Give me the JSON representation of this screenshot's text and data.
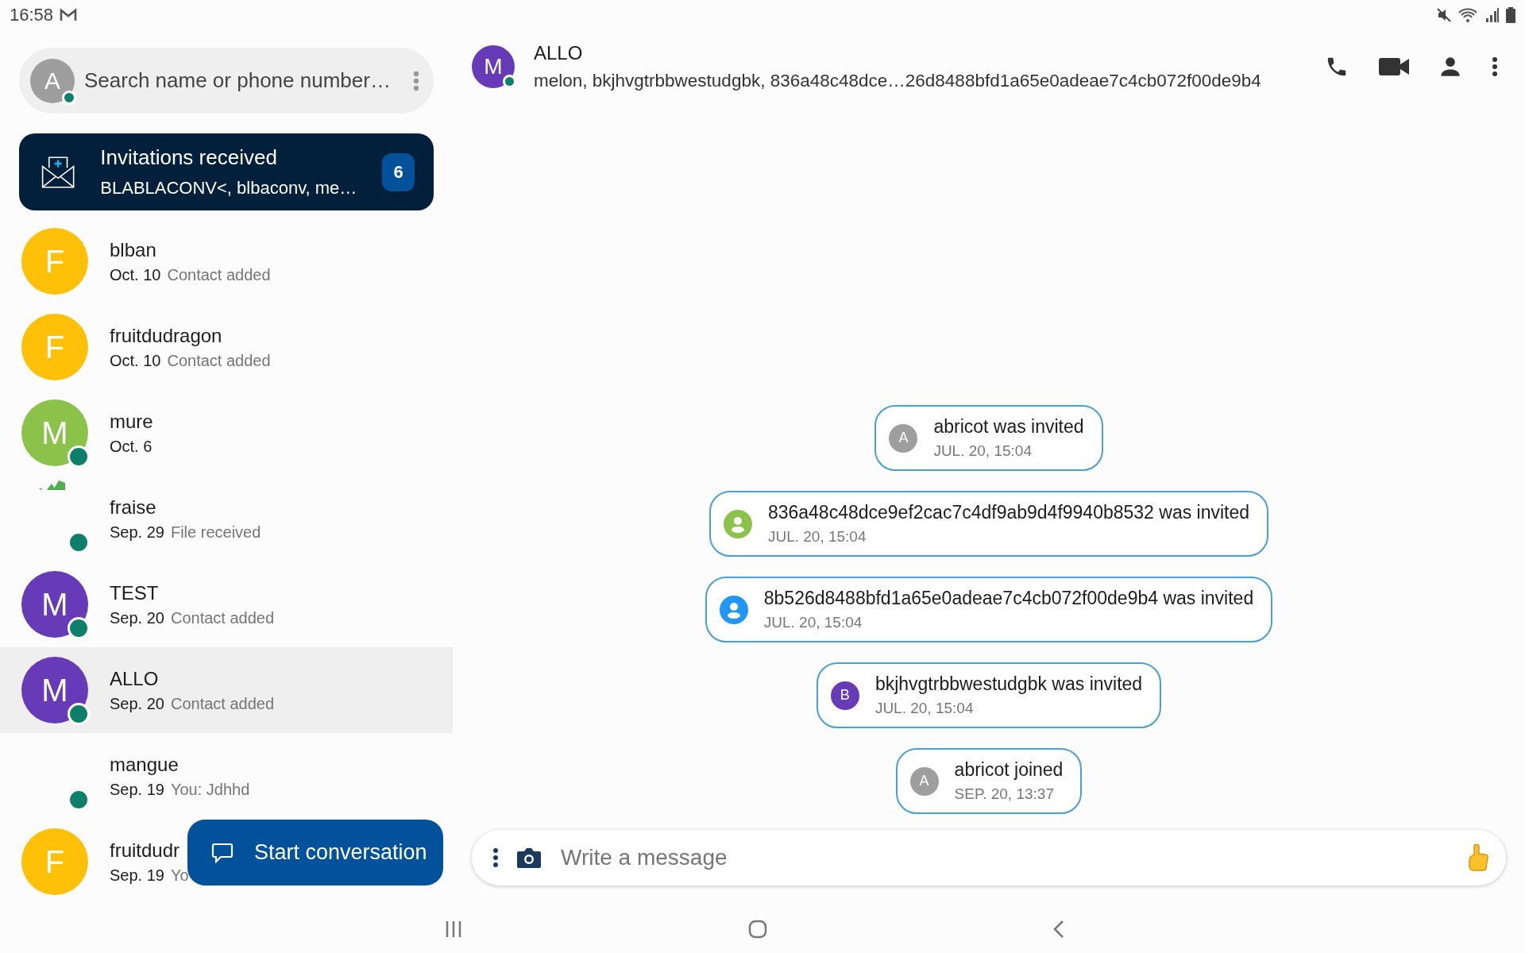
{
  "status_bar": {
    "time": "16:58"
  },
  "search": {
    "avatar_initial": "A",
    "online": true,
    "placeholder": "Search name or phone number…"
  },
  "invitations": {
    "title": "Invitations received",
    "subtitle": "BLABLACONV<, blbaconv, me…",
    "count": "6"
  },
  "contacts": [
    {
      "kind": "letter",
      "initial": "F",
      "color": "#ffc107",
      "name": "blban",
      "date": "Oct. 10",
      "preview": "Contact added",
      "online": false,
      "selected": false
    },
    {
      "kind": "letter",
      "initial": "F",
      "color": "#ffc107",
      "name": "fruitdudragon",
      "date": "Oct. 10",
      "preview": "Contact added",
      "online": false,
      "selected": false
    },
    {
      "kind": "letter",
      "initial": "M",
      "color": "#8bc34a",
      "name": "mure",
      "date": "Oct. 6",
      "online": true,
      "selected": false
    },
    {
      "kind": "broken-image",
      "name": "fraise",
      "date": "Sep. 29",
      "preview": "File received",
      "online": true,
      "selected": false
    },
    {
      "kind": "letter",
      "initial": "M",
      "color": "#673ab7",
      "name": "TEST",
      "date": "Sep. 20",
      "preview": "Contact added",
      "online": true,
      "selected": false
    },
    {
      "kind": "letter",
      "initial": "M",
      "color": "#673ab7",
      "name": "ALLO",
      "date": "Sep. 20",
      "preview": "Contact added",
      "online": true,
      "selected": true
    },
    {
      "kind": "none",
      "name": "mangue",
      "date": "Sep. 19",
      "preview": "You: Jdhhd",
      "online": true,
      "selected": false
    },
    {
      "kind": "letter",
      "initial": "F",
      "color": "#ffc107",
      "name": "fruitdudr",
      "date": "Sep. 19",
      "preview": "Yo",
      "online": false,
      "selected": false
    }
  ],
  "start_button": {
    "label": "Start conversation"
  },
  "header": {
    "avatar_initial": "M",
    "online": true,
    "title": "ALLO",
    "subtitle": "melon, bkjhvgtrbbwestudgbk, 836a48c48dce…26d8488bfd1a65e0adeae7c4cb072f00de9b4"
  },
  "events": [
    {
      "kind": "letter",
      "initial": "A",
      "color": "#9e9e9e",
      "text": "abricot was invited",
      "time": "JUL. 20, 15:04"
    },
    {
      "kind": "person",
      "color": "#8bc34a",
      "text": "836a48c48dce9ef2cac7c4df9ab9d4f9940b8532 was invited",
      "time": "JUL. 20, 15:04"
    },
    {
      "kind": "person",
      "color": "#2196f3",
      "text": "8b526d8488bfd1a65e0adeae7c4cb072f00de9b4 was invited",
      "time": "JUL. 20, 15:04"
    },
    {
      "kind": "letter",
      "initial": "B",
      "color": "#673ab7",
      "text": "bkjhvgtrbbwestudgbk was invited",
      "time": "JUL. 20, 15:04"
    },
    {
      "kind": "letter",
      "initial": "A",
      "color": "#9e9e9e",
      "text": "abricot joined",
      "time": "SEP. 20, 13:37"
    }
  ],
  "composer": {
    "placeholder": "Write a message"
  }
}
